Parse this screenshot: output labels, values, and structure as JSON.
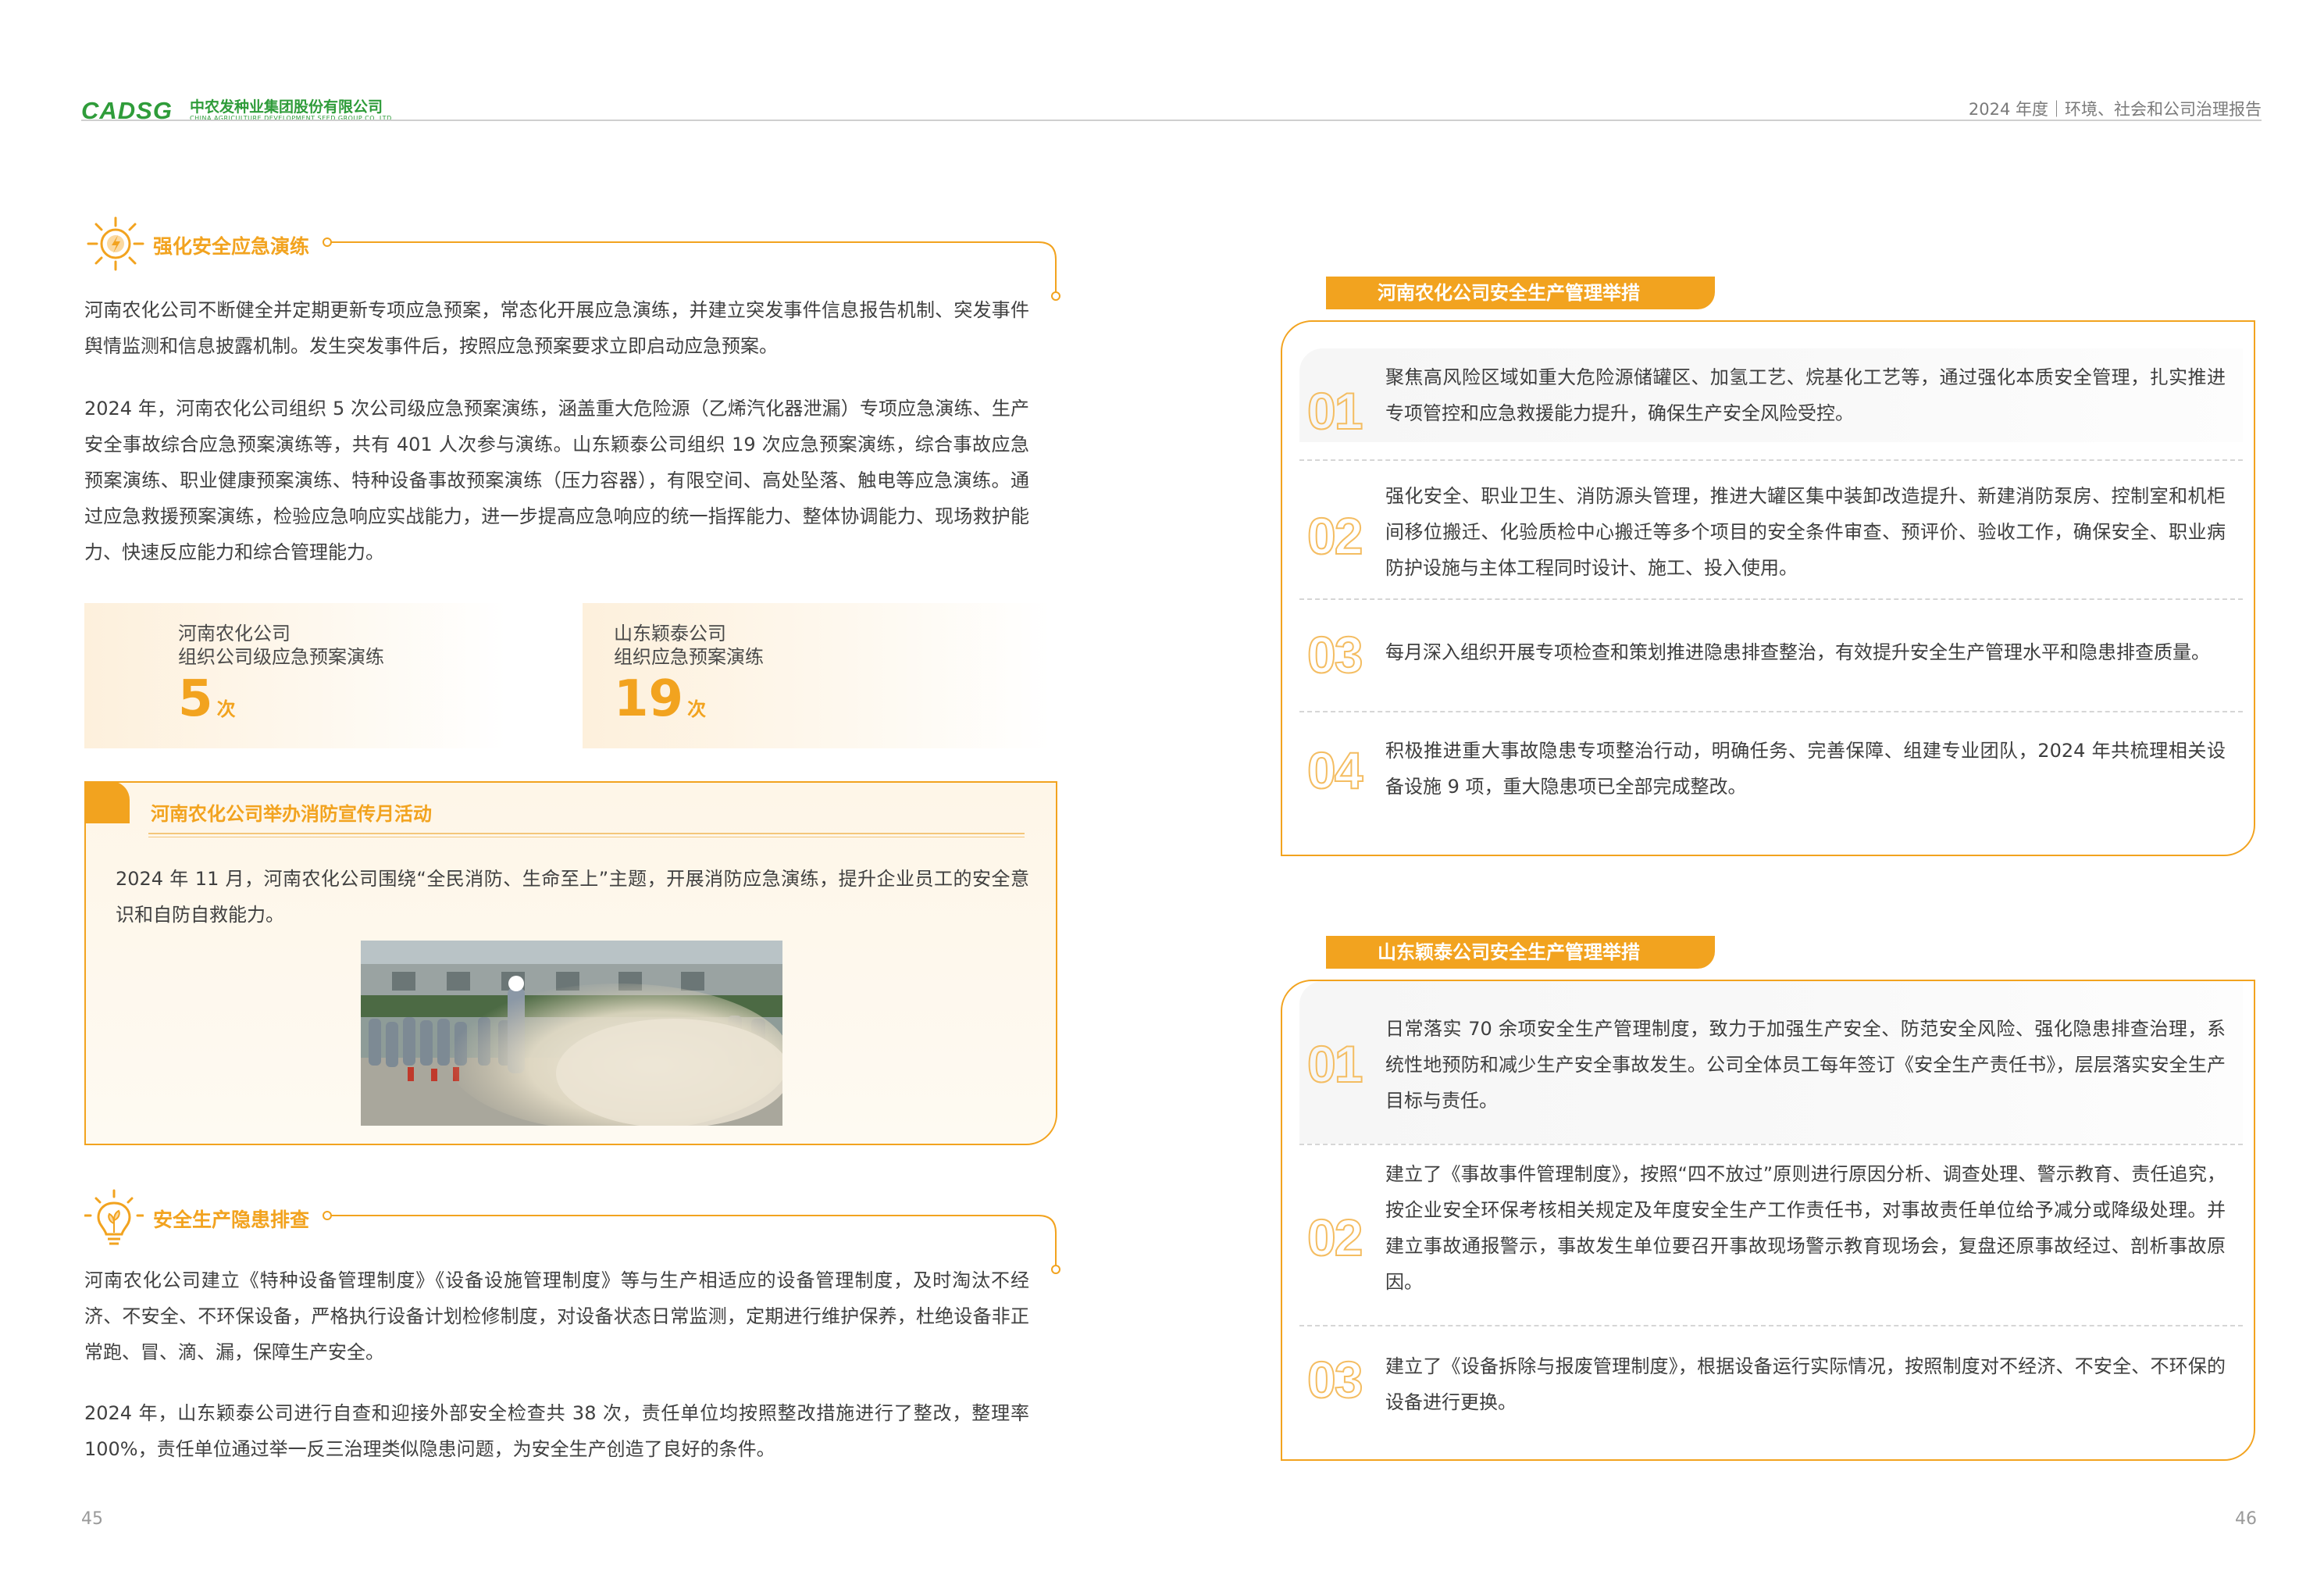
{
  "header": {
    "logo_text": "CADSG",
    "company_cn": "中农发种业集团股份有限公司",
    "company_en": "CHINA AGRICULTURE DEVELOPMENT SEED GROUP CO.,LTD",
    "report_title": "2024 年度｜环境、社会和公司治理报告"
  },
  "left": {
    "section1": {
      "title": "强化安全应急演练",
      "icon": "emergency-radiate-icon",
      "para1": "河南农化公司不断健全并定期更新专项应急预案，常态化开展应急演练，并建立突发事件信息报告机制、突发事件舆情监测和信息披露机制。发生突发事件后，按照应急预案要求立即启动应急预案。",
      "para2": "2024 年，河南农化公司组织 5 次公司级应急预案演练，涵盖重大危险源（乙烯汽化器泄漏）专项应急演练、生产安全事故综合应急预案演练等，共有 401 人次参与演练。山东颖泰公司组织 19 次应急预案演练，综合事故应急预案演练、职业健康预案演练、特种设备事故预案演练（压力容器），有限空间、高处坠落、触电等应急演练。通过应急救援预案演练，检验应急响应实战能力，进一步提高应急响应的统一指挥能力、整体协调能力、现场救护能力、快速反应能力和综合管理能力。"
    },
    "stats": [
      {
        "line1": "河南农化公司",
        "line2": "组织公司级应急预案演练",
        "value": "5",
        "unit": "次"
      },
      {
        "line1": "山东颖泰公司",
        "line2": "组织应急预案演练",
        "value": "19",
        "unit": "次"
      }
    ],
    "case": {
      "title": "河南农化公司举办消防宣传月活动",
      "text": "2024 年 11 月，河南农化公司围绕“全民消防、生命至上”主题，开展消防应急演练，提升企业员工的安全意识和自防自救能力。"
    },
    "section2": {
      "title": "安全生产隐患排查",
      "icon": "lightbulb-leaf-icon",
      "para1": "河南农化公司建立《特种设备管理制度》《设备设施管理制度》等与生产相适应的设备管理制度，及时淘汰不经济、不安全、不环保设备，严格执行设备计划检修制度，对设备状态日常监测，定期进行维护保养，杜绝设备非正常跑、冒、滴、漏，保障生产安全。",
      "para2": "2024 年，山东颖泰公司进行自查和迎接外部安全检查共 38 次，责任单位均按照整改措施进行了整改，整理率 100%，责任单位通过举一反三治理类似隐患问题，为安全生产创造了良好的条件。"
    },
    "page_number": "45"
  },
  "right": {
    "panel1": {
      "title": "河南农化公司安全生产管理举措",
      "items": [
        {
          "num": "01",
          "text": "聚焦高风险区域如重大危险源储罐区、加氢工艺、烷基化工艺等，通过强化本质安全管理，扎实推进专项管控和应急救援能力提升，确保生产安全风险受控。"
        },
        {
          "num": "02",
          "text": "强化安全、职业卫生、消防源头管理，推进大罐区集中装卸改造提升、新建消防泵房、控制室和机柜间移位搬迁、化验质检中心搬迁等多个项目的安全条件审查、预评价、验收工作，确保安全、职业病防护设施与主体工程同时设计、施工、投入使用。"
        },
        {
          "num": "03",
          "text": "每月深入组织开展专项检查和策划推进隐患排查整治，有效提升安全生产管理水平和隐患排查质量。"
        },
        {
          "num": "04",
          "text": "积极推进重大事故隐患专项整治行动，明确任务、完善保障、组建专业团队，2024 年共梳理相关设备设施 9 项，重大隐患项已全部完成整改。"
        }
      ]
    },
    "panel2": {
      "title": "山东颖泰公司安全生产管理举措",
      "items": [
        {
          "num": "01",
          "text": "日常落实 70 余项安全生产管理制度，致力于加强生产安全、防范安全风险、强化隐患排查治理，系统性地预防和减少生产安全事故发生。公司全体员工每年签订《安全生产责任书》，层层落实安全生产目标与责任。"
        },
        {
          "num": "02",
          "text": "建立了《事故事件管理制度》，按照“四不放过”原则进行原因分析、调查处理、警示教育、责任追究，按企业安全环保考核相关规定及年度安全生产工作责任书，对事故责任单位给予减分或降级处理。并建立事故通报警示，事故发生单位要召开事故现场警示教育现场会，复盘还原事故经过、剖析事故原因。"
        },
        {
          "num": "03",
          "text": "建立了《设备拆除与报废管理制度》，根据设备运行实际情况，按照制度对不经济、不安全、不环保的设备进行更换。"
        }
      ]
    },
    "page_number": "46"
  },
  "colors": {
    "accent": "#f2a31f",
    "brand_green": "#2f9c3a",
    "text": "#3a3a3a"
  }
}
